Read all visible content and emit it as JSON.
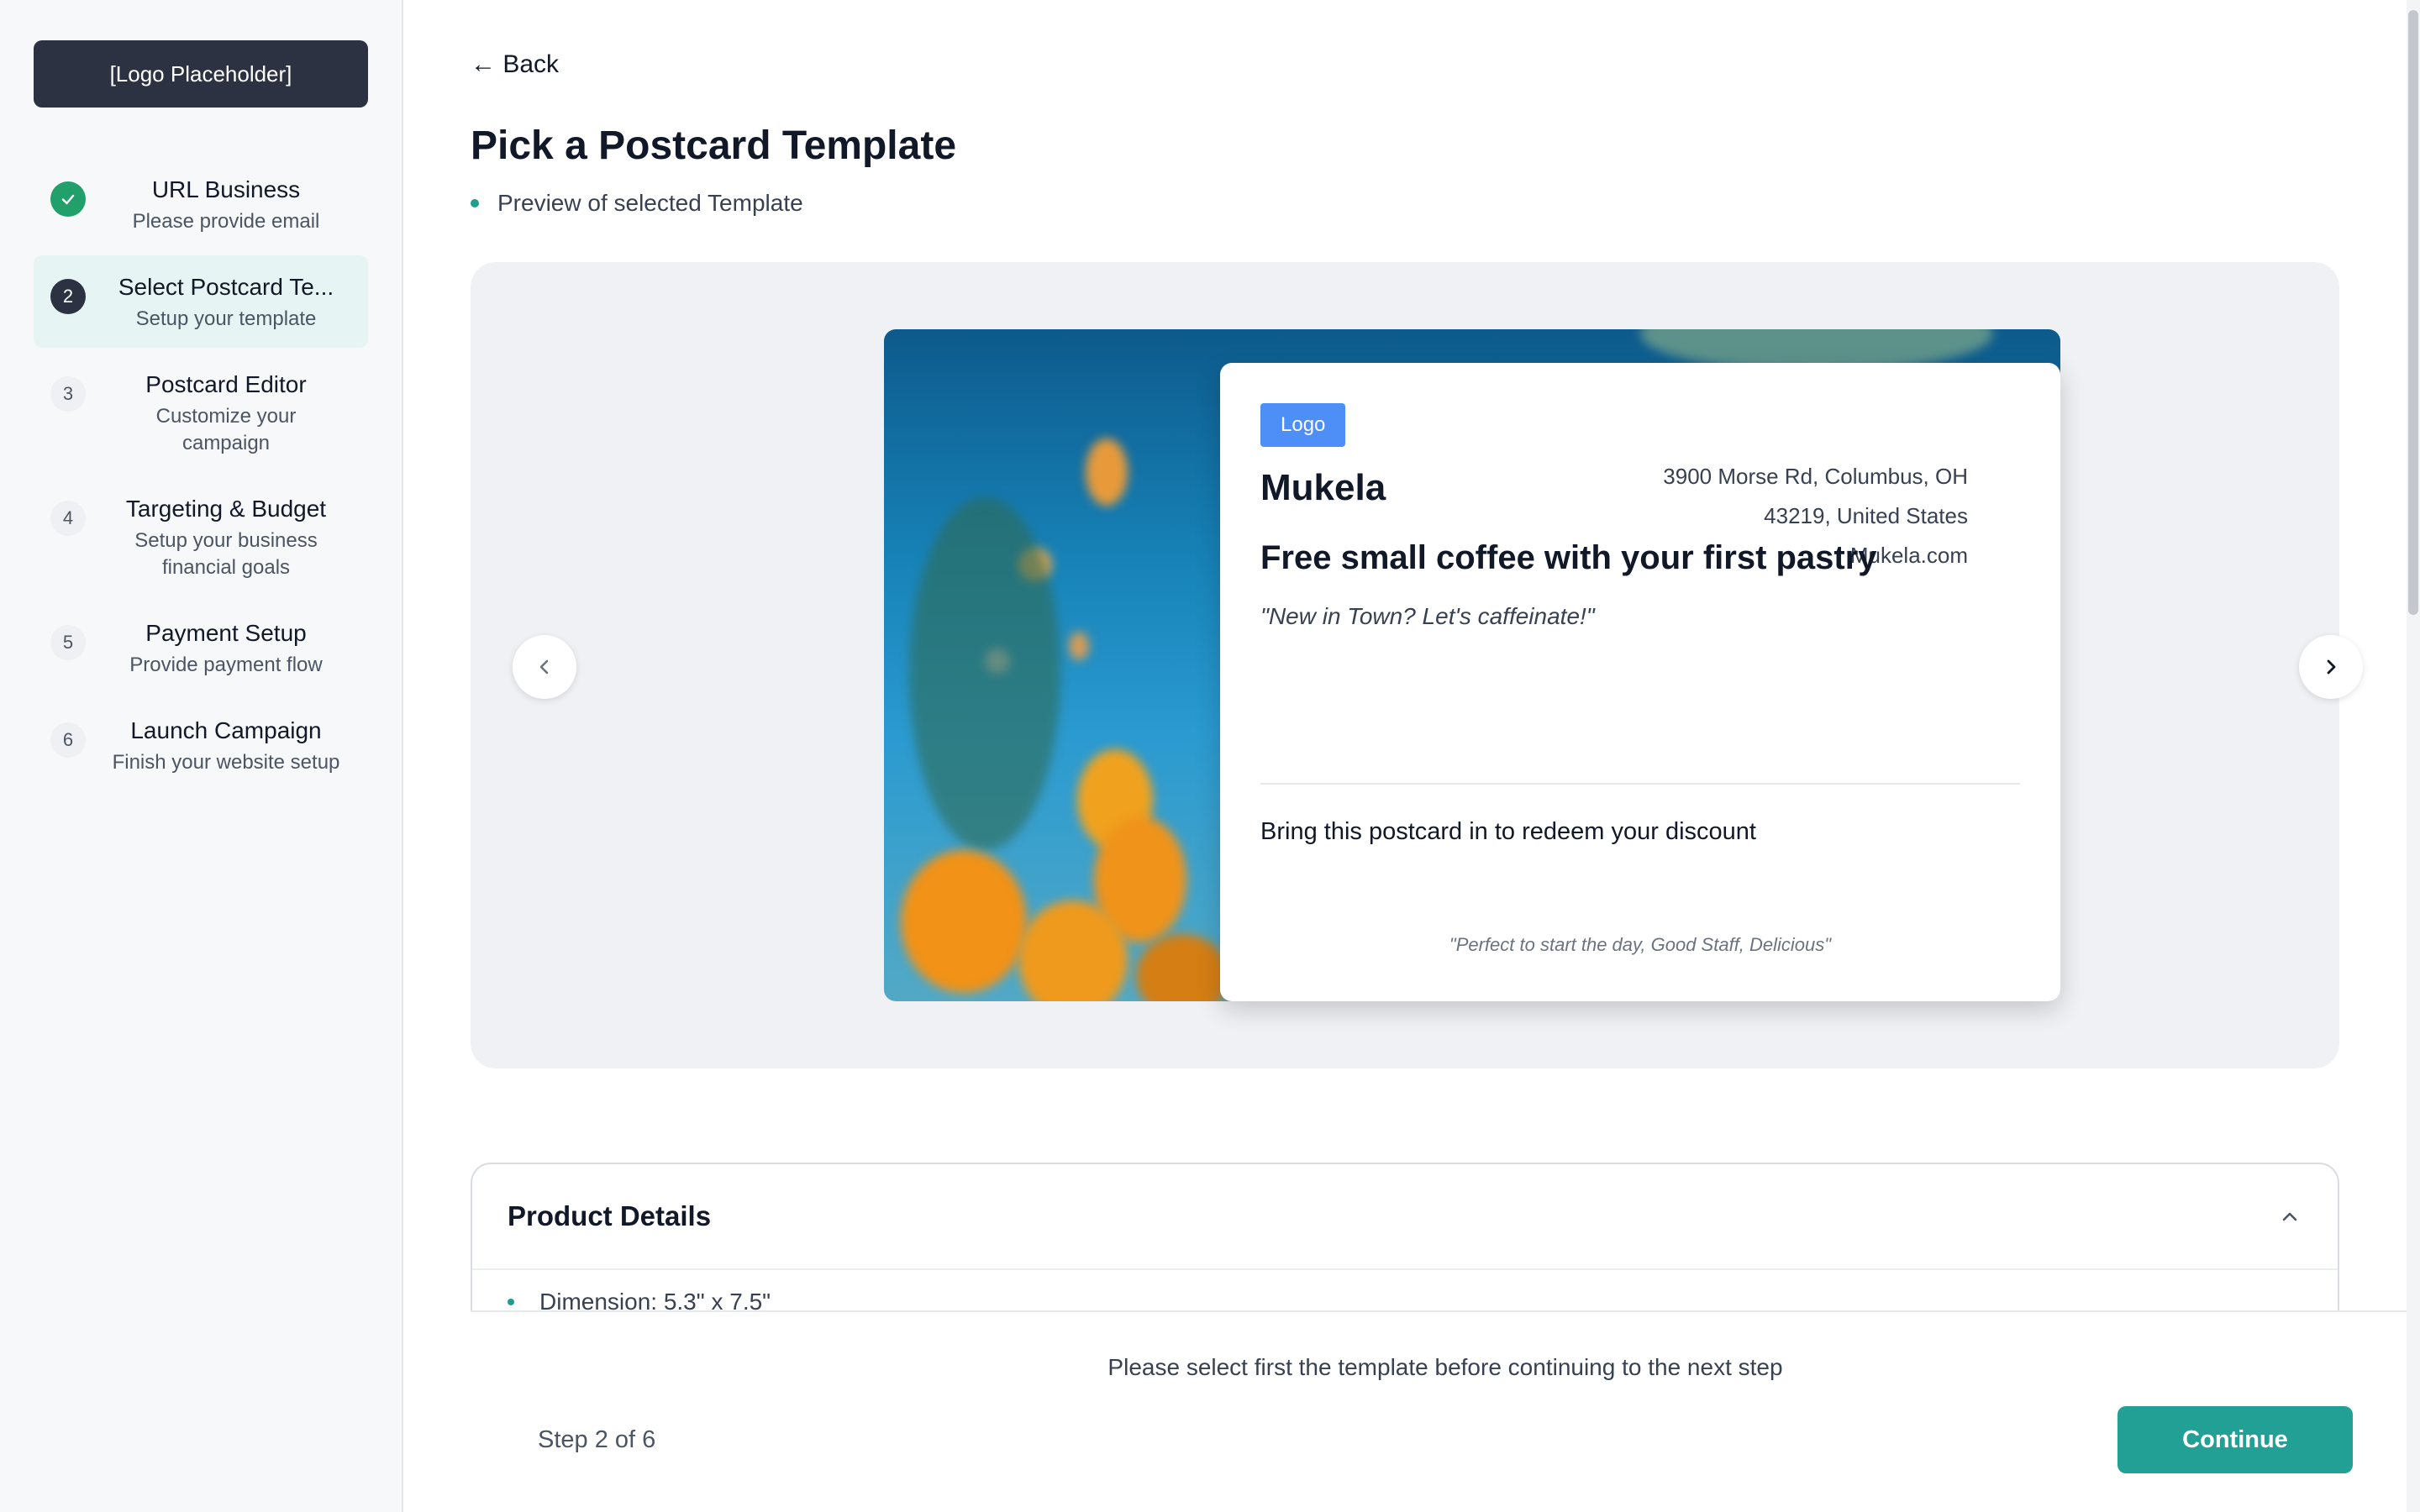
{
  "sidebar": {
    "logo": "[Logo Placeholder]",
    "steps": [
      {
        "number": "✓",
        "title": "URL Business",
        "subtitle": "Please provide email",
        "state": "done"
      },
      {
        "number": "2",
        "title": "Select Postcard Te...",
        "subtitle": "Setup your template",
        "state": "current"
      },
      {
        "number": "3",
        "title": "Postcard Editor",
        "subtitle": "Customize your campaign",
        "state": "pending"
      },
      {
        "number": "4",
        "title": "Targeting & Budget",
        "subtitle": "Setup your business financial goals",
        "state": "pending"
      },
      {
        "number": "5",
        "title": "Payment Setup",
        "subtitle": "Provide payment flow",
        "state": "pending"
      },
      {
        "number": "6",
        "title": "Launch Campaign",
        "subtitle": "Finish your website setup",
        "state": "pending"
      }
    ]
  },
  "header": {
    "back": "← Back",
    "title": "Pick a Postcard Template",
    "note": "Preview of selected Template"
  },
  "postcard": {
    "logo": "Logo",
    "business": "Mukela",
    "address_line1": "3900 Morse Rd, Columbus, OH",
    "address_line2": "43219, United States",
    "website": "Mukela.com",
    "offer": "Free small coffee with your first pastry",
    "tagline": "\"New in Town? Let's caffeinate!\"",
    "redeem": "Bring this postcard in to redeem your discount",
    "review": "\"Perfect to start the day, Good Staff, Delicious\""
  },
  "details": {
    "title": "Product Details",
    "items": [
      "Dimension: 5.3\" x 7.5\""
    ]
  },
  "footer": {
    "message": "Please select first the template before continuing to the next step",
    "step": "Step 2 of 6",
    "continue": "Continue"
  },
  "colors": {
    "accent": "#23a095",
    "sidebar_active": "#e6f5f3",
    "done": "#22a06b",
    "logo_badge": "#4e8ef7"
  }
}
